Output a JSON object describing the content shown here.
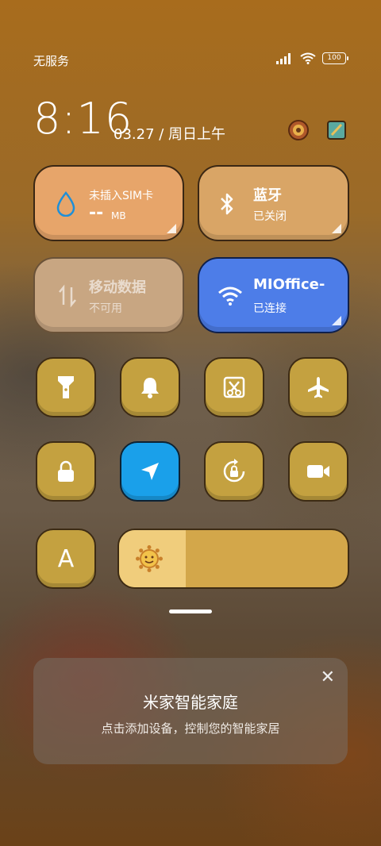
{
  "status": {
    "carrier": "无服务",
    "battery": "100"
  },
  "clock": {
    "time": "8:16",
    "date": "03.27 / 周日上午"
  },
  "tiles": {
    "sim": {
      "title": "未插入SIM卡",
      "value": "--",
      "unit": "MB"
    },
    "bluetooth": {
      "title": "蓝牙",
      "status": "已关闭"
    },
    "mobile_data": {
      "title": "移动数据",
      "status": "不可用"
    },
    "wifi": {
      "title": "MIOffice-",
      "status": "已连接"
    }
  },
  "toggles": [
    {
      "name": "flashlight-icon",
      "active": false
    },
    {
      "name": "bell-icon",
      "active": false
    },
    {
      "name": "screenshot-icon",
      "active": false
    },
    {
      "name": "airplane-icon",
      "active": false
    },
    {
      "name": "lock-icon",
      "active": false
    },
    {
      "name": "location-icon",
      "active": true
    },
    {
      "name": "rotation-lock-icon",
      "active": false
    },
    {
      "name": "video-icon",
      "active": false
    }
  ],
  "font_toggle_label": "A",
  "brightness": {
    "level": 0.29
  },
  "mijia": {
    "title": "米家智能家庭",
    "subtitle": "点击添加设备，控制您的智能家居",
    "close": "✕"
  },
  "colors": {
    "sim_tile": "#e7a56a",
    "bluetooth_tile": "#d9a566",
    "mobile_tile": "#c8a682",
    "wifi_tile": "#4d7de8",
    "toggle": "#c4a140",
    "active_toggle": "#1aa0ea"
  }
}
